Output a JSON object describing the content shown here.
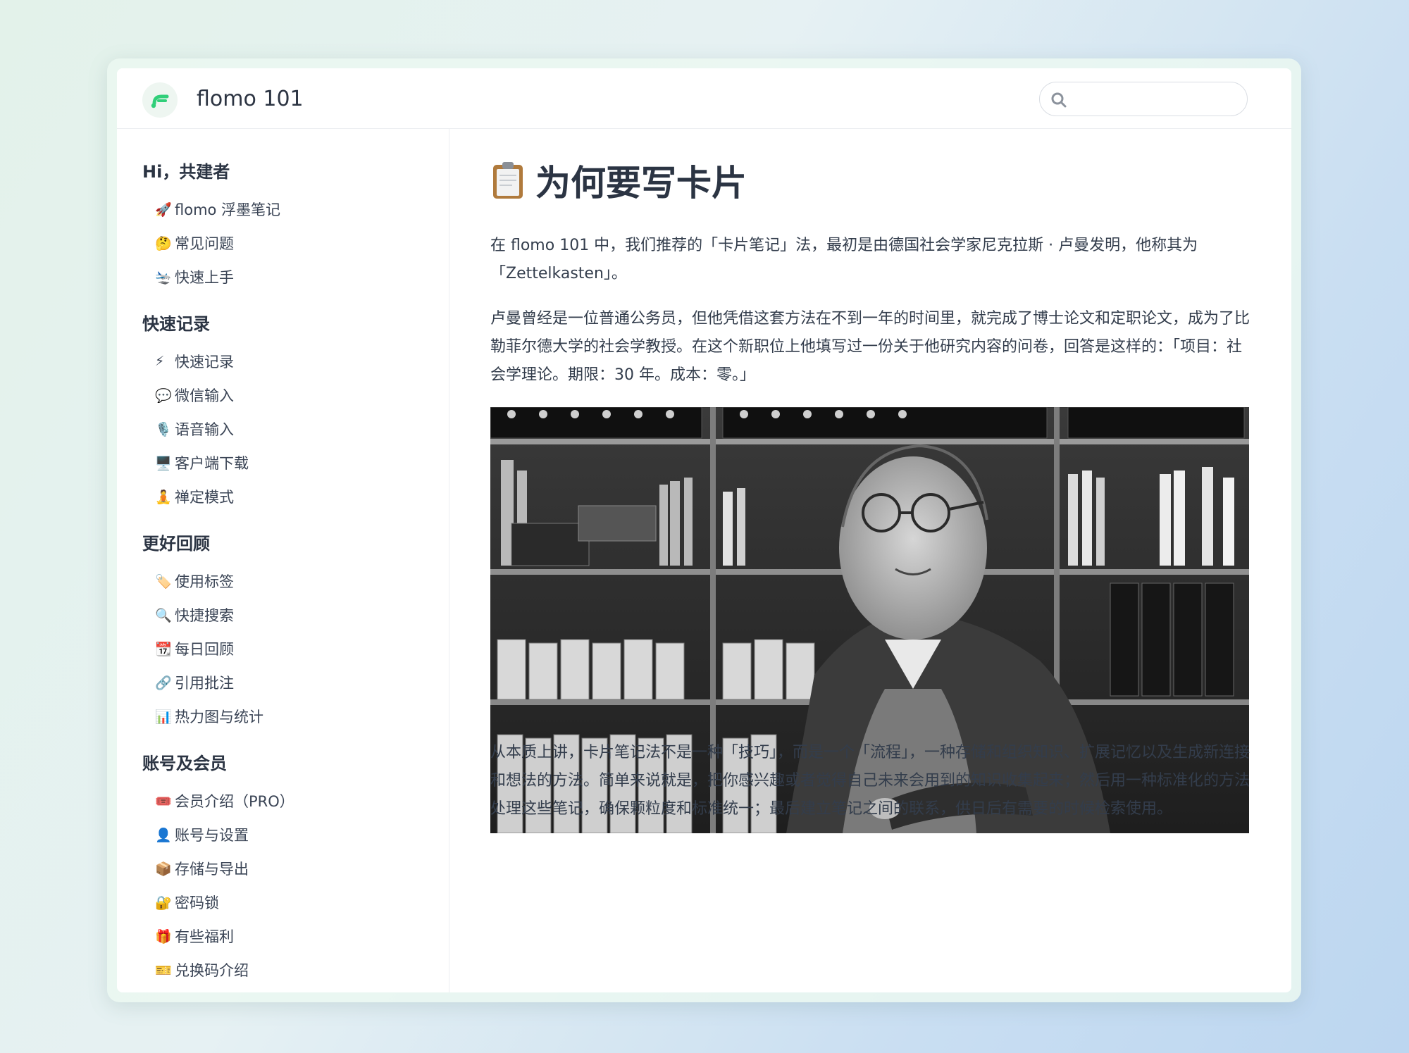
{
  "app": {
    "title": "flomo 101"
  },
  "search": {
    "placeholder": ""
  },
  "sidebar": {
    "groups": [
      {
        "title": "Hi，共建者",
        "items": [
          {
            "icon": "🚀",
            "label": "flomo 浮墨笔记"
          },
          {
            "icon": "🤔",
            "label": "常见问题"
          },
          {
            "icon": "🛬",
            "label": "快速上手"
          }
        ]
      },
      {
        "title": "快速记录",
        "items": [
          {
            "icon": "⚡",
            "label": "快速记录"
          },
          {
            "icon": "💬",
            "label": "微信输入"
          },
          {
            "icon": "🎙️",
            "label": "语音输入"
          },
          {
            "icon": "🖥️",
            "label": "客户端下载"
          },
          {
            "icon": "🧘",
            "label": "禅定模式"
          }
        ]
      },
      {
        "title": "更好回顾",
        "items": [
          {
            "icon": "🏷️",
            "label": "使用标签"
          },
          {
            "icon": "🔍",
            "label": "快捷搜索"
          },
          {
            "icon": "📆",
            "label": "每日回顾"
          },
          {
            "icon": "🔗",
            "label": "引用批注"
          },
          {
            "icon": "📊",
            "label": "热力图与统计"
          }
        ]
      },
      {
        "title": "账号及会员",
        "items": [
          {
            "icon": "🎟️",
            "label": "会员介绍（PRO）"
          },
          {
            "icon": "👤",
            "label": "账号与设置"
          },
          {
            "icon": "📦",
            "label": "存储与导出"
          },
          {
            "icon": "🔐",
            "label": "密码锁"
          },
          {
            "icon": "🎁",
            "label": "有些福利"
          },
          {
            "icon": "🎫",
            "label": "兑换码介绍"
          }
        ]
      }
    ]
  },
  "article": {
    "title": "为何要写卡片",
    "title_icon": "clipboard-icon",
    "p1": "在 flomo 101 中，我们推荐的「卡片笔记」法，最初是由德国社会学家尼克拉斯 · 卢曼发明，他称其为「Zettelkasten」。",
    "p2": "卢曼曾经是一位普通公务员，但他凭借这套方法在不到一年的时间里，就完成了博士论文和定职论文，成为了比勒菲尔德大学的社会学教授。在这个新职位上他填写过一份关于他研究内容的问卷，回答是这样的：「项目：社会学理论。期限：30 年。成本：零。」",
    "image": "black-and-white photograph of an elderly man with glasses standing with arms crossed in front of bookshelves full of binders and card boxes",
    "p3": "从本质上讲，卡片笔记法不是一种「技巧」，而是一个「流程」，一种存储和组织知识、扩展记忆以及生成新连接和想法的方法。简单来说就是，把你感兴趣或者觉得自己未来会用到的知识收集起来；然后用一种标准化的方法处理这些笔记，确保颗粒度和标准统一；最后建立笔记之间的联系，供日后有需要的时候检索使用。"
  },
  "colors": {
    "brand_green": "#30cf79",
    "text": "#2f3a4b"
  }
}
